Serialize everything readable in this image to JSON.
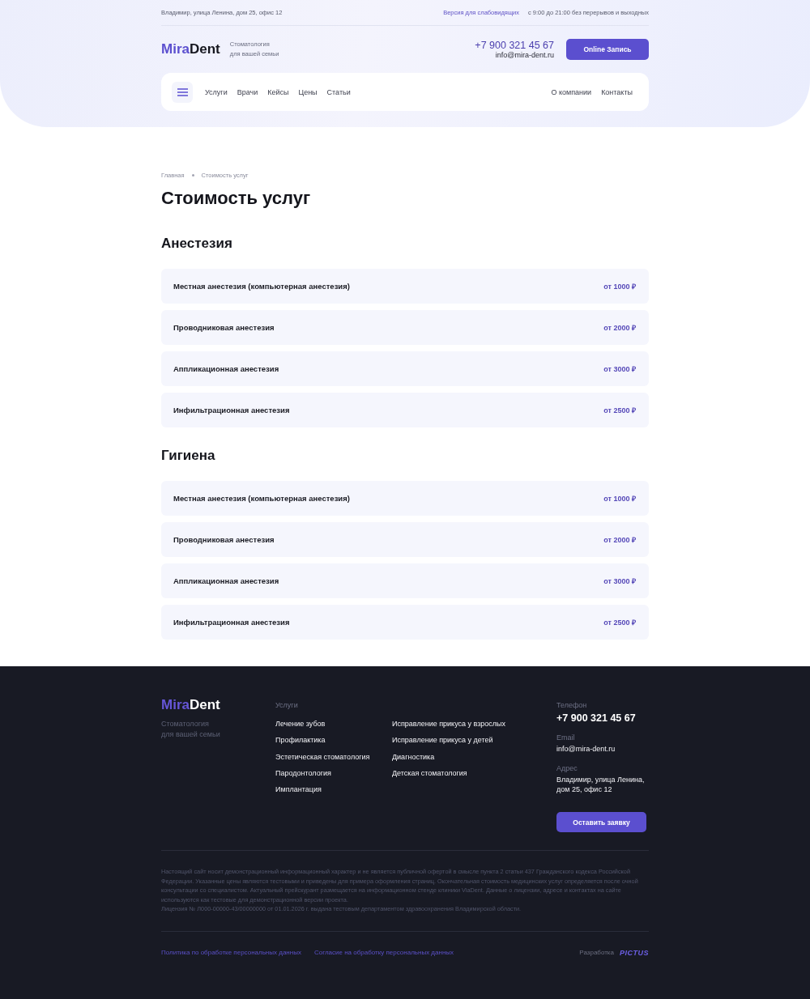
{
  "top_bar": {
    "address": "Владимир, улица Ленина, дом 25, офис 12",
    "accessibility_link": "Версия для слабовидящих",
    "hours": "с 9:00 до 21:00 без перерывов и выходных"
  },
  "header": {
    "logo": {
      "accent": "Mira",
      "rest": "Dent"
    },
    "tagline": [
      "Стоматология",
      "для вашей семьи"
    ],
    "phone": "+7 900 321 45 67",
    "email": "info@mira-dent.ru",
    "button": "Online Запись"
  },
  "nav": {
    "left": [
      "Услуги",
      "Врачи",
      "Кейсы",
      "Цены",
      "Статьи"
    ],
    "right": [
      "О компании",
      "Контакты"
    ]
  },
  "breadcrumbs": [
    "Главная",
    "Стоимость услуг"
  ],
  "title": "Стоимость услуг",
  "sections": [
    {
      "heading": "Анестезия",
      "items": [
        {
          "name": "Местная анестезия (компьютерная анестезия)",
          "price": "от 1000 ₽"
        },
        {
          "name": "Проводниковая анестезия",
          "price": "от 2000 ₽"
        },
        {
          "name": "Аппликационная анестезия",
          "price": "от 3000 ₽"
        },
        {
          "name": "Инфильтрационная анестезия",
          "price": "от 2500 ₽"
        }
      ]
    },
    {
      "heading": "Гигиена",
      "items": [
        {
          "name": "Местная анестезия (компьютерная анестезия)",
          "price": "от 1000 ₽"
        },
        {
          "name": "Проводниковая анестезия",
          "price": "от 2000 ₽"
        },
        {
          "name": "Аппликационная анестезия",
          "price": "от 3000 ₽"
        },
        {
          "name": "Инфильтрационная анестезия",
          "price": "от 2500 ₽"
        }
      ]
    }
  ],
  "footer": {
    "logo": {
      "accent": "Mira",
      "rest": "Dent"
    },
    "tagline": [
      "Стоматология",
      "для вашей семьи"
    ],
    "services": {
      "heading": "Услуги",
      "columns": [
        [
          "Лечение зубов",
          "Профилактика",
          "Эстетическая стоматология",
          "Пародонтология",
          "Имплантация"
        ],
        [
          "Исправление прикуса у взрослых",
          "Исправление прикуса у детей",
          "Диагностика",
          "Детская стоматология"
        ]
      ]
    },
    "contacts": {
      "phone_label": "Телефон",
      "phone": "+7 900 321 45 67",
      "email_label": "Email",
      "email": "info@mira-dent.ru",
      "address_label": "Адрес",
      "address": [
        "Владимир, улица Ленина,",
        "дом 25, офис 12"
      ],
      "button": "Оставить заявку"
    },
    "disclaimer": [
      "Настоящий сайт носит демонстрационный информационный характер и не является публичной офертой в смысле пункта 2 статьи 437 Гражданского кодекса Российской Федерации. Указанные цены являются тестовыми и приведены для примера оформления страниц. Окончательная стоимость медицинских услуг определяется после очной консультации со специалистом. Актуальный прейскурант размещается на информационном стенде клиники ViaDent. Данные о лицензии, адресе и контактах на сайте используются как тестовые для демонстрационной версии проекта.",
      "Лицензия № Л000-00000-43/00000000 от 01.01.2026 г. выдана тестовым департаментом здравоохранения Владимирской области."
    ],
    "links": [
      "Политика по обработке персональных данных",
      "Согласие на обработку персональных данных"
    ],
    "developer_label": "Разработка",
    "developer_logo": "PICTUS"
  }
}
